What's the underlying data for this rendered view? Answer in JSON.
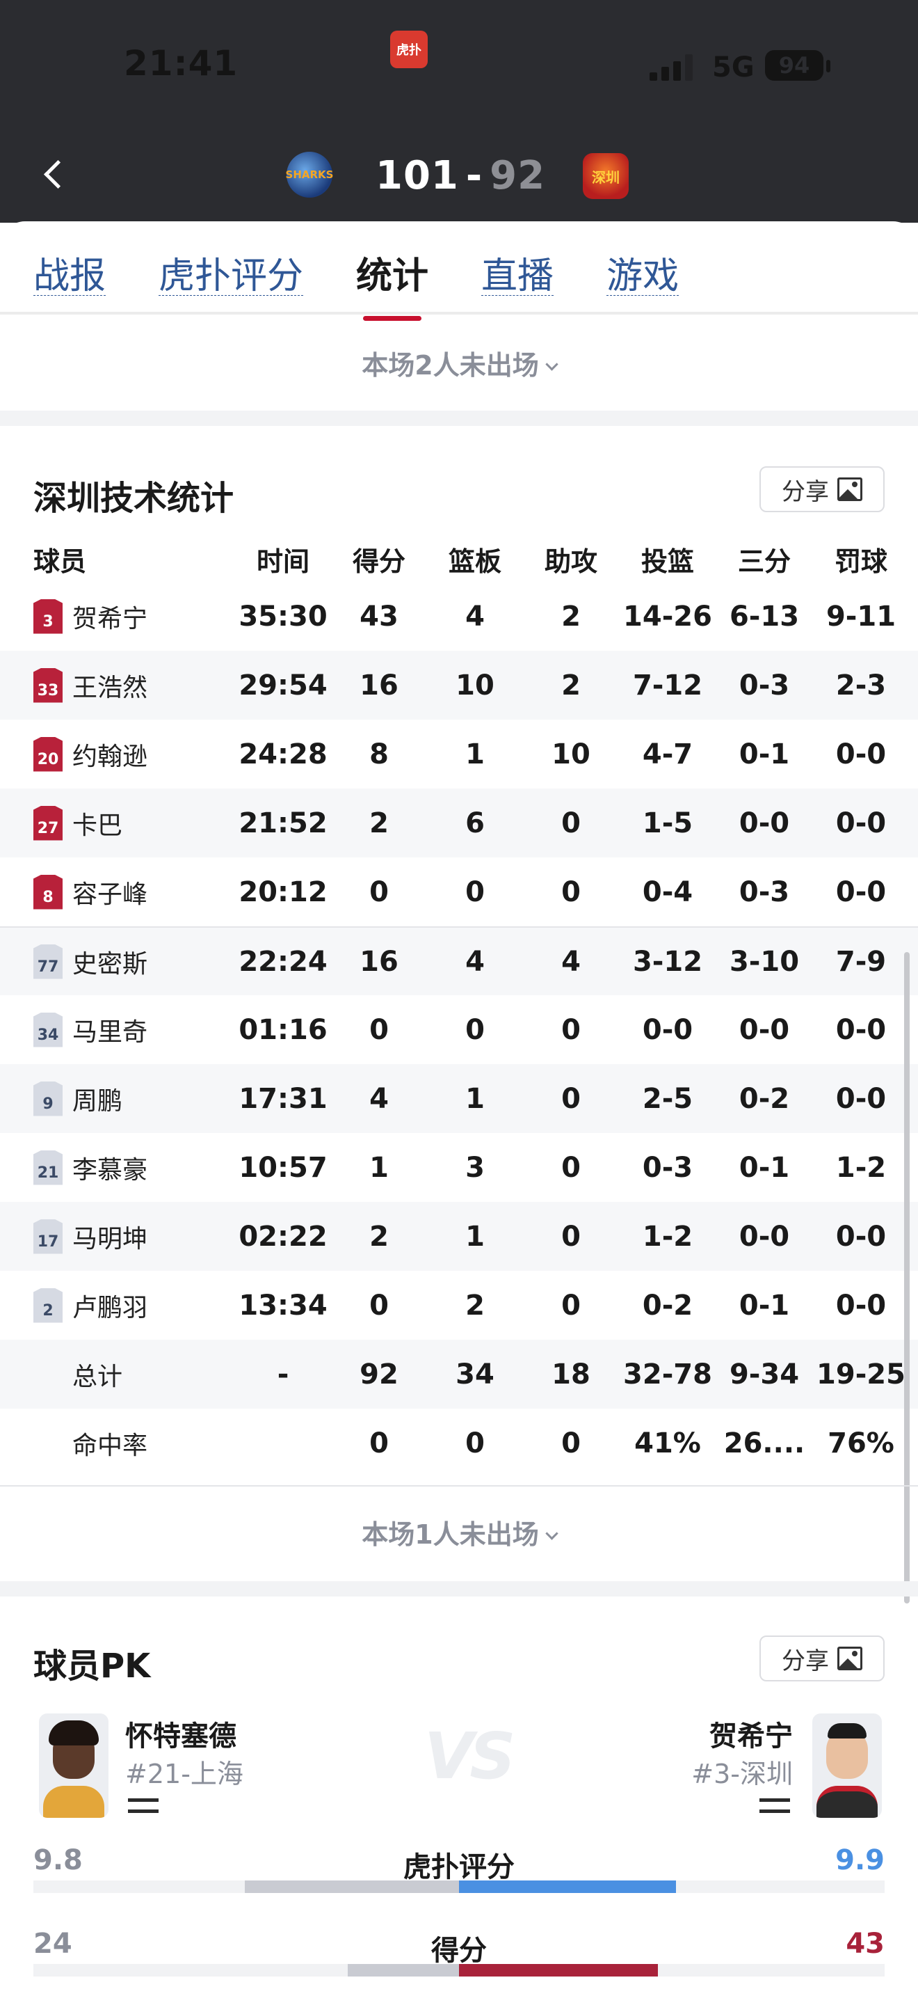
{
  "status": {
    "time": "21:41",
    "network": "5G",
    "battery": "94",
    "app_icon": "虎扑"
  },
  "header": {
    "home_score": "101",
    "separator": "-",
    "away_score": "92",
    "home_logo_text": "SHARKS",
    "away_logo_text": "深圳",
    "colors": {
      "background": "#2b2c30",
      "home_score": "#ffffff",
      "away_score": "#8e8f95"
    }
  },
  "tabs": [
    {
      "label": "战报",
      "active": false
    },
    {
      "label": "虎扑评分",
      "active": false
    },
    {
      "label": "统计",
      "active": true
    },
    {
      "label": "直播",
      "active": false
    },
    {
      "label": "游戏",
      "active": false
    }
  ],
  "top_absent_note": "本场2人未出场",
  "stats": {
    "title": "深圳技术统计",
    "share_label": "分享",
    "columns": [
      "球员",
      "时间",
      "得分",
      "篮板",
      "助攻",
      "投篮",
      "三分",
      "罚球"
    ],
    "starters": [
      {
        "number": "3",
        "name": "贺希宁",
        "time": "35:30",
        "pts": "43",
        "reb": "4",
        "ast": "2",
        "fg": "14-26",
        "tp": "6-13",
        "ft": "9-11"
      },
      {
        "number": "33",
        "name": "王浩然",
        "time": "29:54",
        "pts": "16",
        "reb": "10",
        "ast": "2",
        "fg": "7-12",
        "tp": "0-3",
        "ft": "2-3"
      },
      {
        "number": "20",
        "name": "约翰逊",
        "time": "24:28",
        "pts": "8",
        "reb": "1",
        "ast": "10",
        "fg": "4-7",
        "tp": "0-1",
        "ft": "0-0"
      },
      {
        "number": "27",
        "name": "卡巴",
        "time": "21:52",
        "pts": "2",
        "reb": "6",
        "ast": "0",
        "fg": "1-5",
        "tp": "0-0",
        "ft": "0-0"
      },
      {
        "number": "8",
        "name": "容子峰",
        "time": "20:12",
        "pts": "0",
        "reb": "0",
        "ast": "0",
        "fg": "0-4",
        "tp": "0-3",
        "ft": "0-0"
      }
    ],
    "bench": [
      {
        "number": "77",
        "name": "史密斯",
        "time": "22:24",
        "pts": "16",
        "reb": "4",
        "ast": "4",
        "fg": "3-12",
        "tp": "3-10",
        "ft": "7-9"
      },
      {
        "number": "34",
        "name": "马里奇",
        "time": "01:16",
        "pts": "0",
        "reb": "0",
        "ast": "0",
        "fg": "0-0",
        "tp": "0-0",
        "ft": "0-0"
      },
      {
        "number": "9",
        "name": "周鹏",
        "time": "17:31",
        "pts": "4",
        "reb": "1",
        "ast": "0",
        "fg": "2-5",
        "tp": "0-2",
        "ft": "0-0"
      },
      {
        "number": "21",
        "name": "李慕豪",
        "time": "10:57",
        "pts": "1",
        "reb": "3",
        "ast": "0",
        "fg": "0-3",
        "tp": "0-1",
        "ft": "1-2"
      },
      {
        "number": "17",
        "name": "马明坤",
        "time": "02:22",
        "pts": "2",
        "reb": "1",
        "ast": "0",
        "fg": "1-2",
        "tp": "0-0",
        "ft": "0-0"
      },
      {
        "number": "2",
        "name": "卢鹏羽",
        "time": "13:34",
        "pts": "0",
        "reb": "2",
        "ast": "0",
        "fg": "0-2",
        "tp": "0-1",
        "ft": "0-0"
      }
    ],
    "totals": {
      "label": "总计",
      "time": "-",
      "pts": "92",
      "reb": "34",
      "ast": "18",
      "fg": "32-78",
      "tp": "9-34",
      "ft": "19-25"
    },
    "percent": {
      "label": "命中率",
      "pts": "0",
      "reb": "0",
      "ast": "0",
      "fg": "41%",
      "tp": "26....",
      "ft": "76%"
    },
    "absent_note": "本场1人未出场",
    "colors": {
      "starter_jersey": "#b8213a",
      "bench_jersey": "#d6dae3"
    }
  },
  "pk": {
    "title": "球员PK",
    "share_label": "分享",
    "left": {
      "name": "怀特塞德",
      "sub": "#21-上海"
    },
    "right": {
      "name": "贺希宁",
      "sub": "#3-深圳"
    },
    "vs": "VS",
    "metrics": [
      {
        "label": "虎扑评分",
        "left": "9.8",
        "right": "9.9",
        "left_value": 9.8,
        "right_value": 9.9,
        "right_color": "#4a90e2",
        "left_color": "#c9cbd2"
      },
      {
        "label": "得分",
        "left": "24",
        "right": "43",
        "left_value": 24,
        "right_value": 43,
        "right_color": "#a8223a",
        "left_color": "#c9cbd2"
      }
    ]
  }
}
